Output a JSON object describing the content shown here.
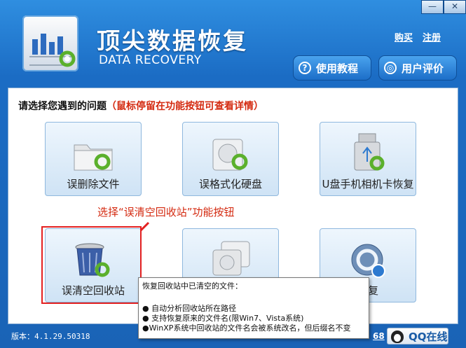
{
  "window": {
    "min_glyph": "—",
    "close_glyph": "✕"
  },
  "header": {
    "title_cn": "顶尖数据恢复",
    "title_en": "DATA RECOVERY",
    "links": [
      "购买",
      "注册"
    ],
    "buttons": [
      {
        "label": "使用教程",
        "icon": "question-circle-icon",
        "glyph": "?"
      },
      {
        "label": "用户评价",
        "icon": "chat-bubble-icon",
        "glyph": "◎"
      }
    ]
  },
  "main": {
    "prompt": "请选择您遇到的问题",
    "hint": "（鼠标停留在功能按钮可查看详情）",
    "annotation": "选择“误清空回收站”功能按钮",
    "cards": [
      {
        "label": "误删除文件",
        "icon": "folder-recover-icon"
      },
      {
        "label": "误格式化硬盘",
        "icon": "hard-drive-recover-icon"
      },
      {
        "label": "U盘手机相机卡恢复",
        "icon": "usb-recover-icon"
      },
      {
        "label": "误清空回收站",
        "icon": "recycle-bin-recover-icon"
      },
      {
        "label": "",
        "icon": "partition-recover-icon"
      },
      {
        "label": "恢复",
        "icon": "advanced-recover-icon"
      }
    ]
  },
  "tooltip": {
    "title": "恢复回收站中已清空的文件：",
    "items": [
      "自动分析回收站所在路径",
      "支持恢复原来的文件名(限Win7、Vista系统)",
      "WinXP系统中回收站的文件名会被系统改名，但后缀名不变"
    ]
  },
  "footer": {
    "version": "版本：4.1.29.50318",
    "number": "68",
    "qq_label": "QQ在线"
  },
  "colors": {
    "accent": "#1d6fc0",
    "hint_red": "#d42a10"
  }
}
